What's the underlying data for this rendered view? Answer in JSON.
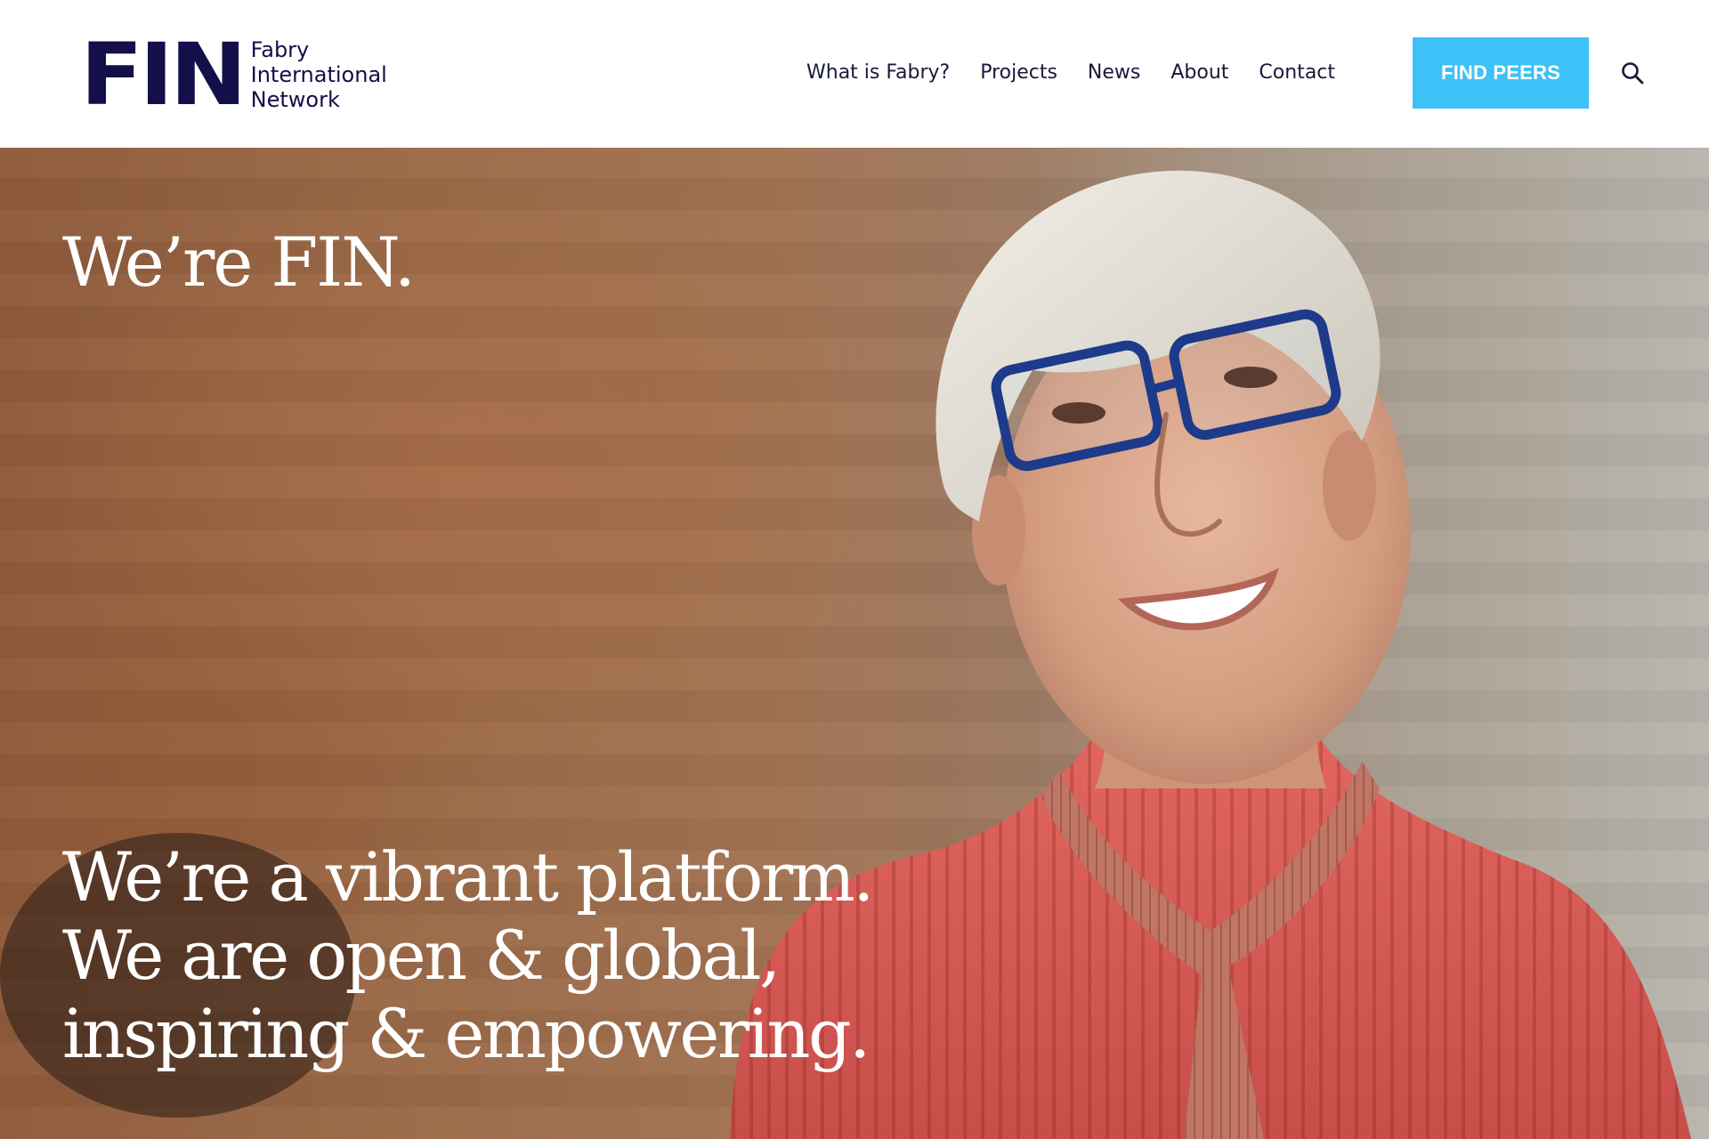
{
  "brand": {
    "mark": "FIN",
    "name_lines": [
      "Fabry",
      "International",
      "Network"
    ]
  },
  "nav": {
    "items": [
      {
        "label": "What is Fabry?"
      },
      {
        "label": "Projects"
      },
      {
        "label": "News"
      },
      {
        "label": "About"
      },
      {
        "label": "Contact"
      }
    ],
    "cta_label": "FIND PEERS",
    "search_icon": "search-icon"
  },
  "hero": {
    "title": "We’re FIN.",
    "tagline_lines": [
      "We’re a vibrant platform.",
      "We are open & global,",
      "inspiring & empowering."
    ]
  },
  "colors": {
    "brand_navy": "#130f4a",
    "cta_blue": "#3ec1f7",
    "text_dark": "#171a3a",
    "hero_text": "#ffffff"
  }
}
